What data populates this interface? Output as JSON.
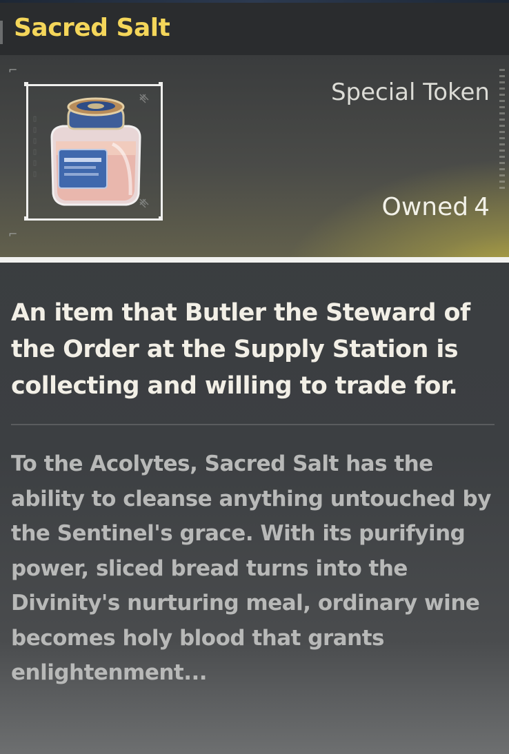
{
  "item": {
    "name": "Sacred Salt",
    "category": "Special Token",
    "owned_label": "Owned",
    "owned_count": "4",
    "summary": "An item that Butler the Steward of the Order at the Supply Station is collecting and willing to trade for.",
    "lore": "To the Acolytes, Sacred Salt has the ability to cleanse anything untouched by the Sentinel's grace. With its purifying power, sliced bread turns into the Divinity's nurturing meal, ordinary wine becomes holy blood that grants enlightenment...",
    "icon": "salt-jar-icon"
  },
  "colors": {
    "title": "#f4d65a",
    "accent_glow": "#d6c43c",
    "summary_text": "#f2efe6",
    "lore_text": "#b8b9b8"
  }
}
